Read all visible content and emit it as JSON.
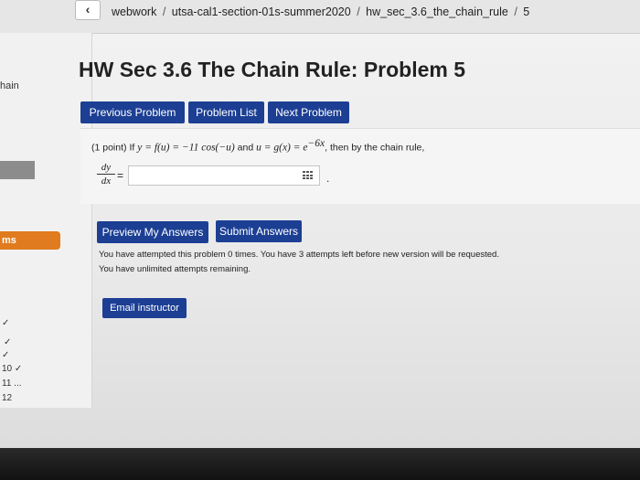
{
  "breadcrumb": {
    "items": [
      "webwork",
      "utsa-cal1-section-01s-summer2020",
      "hw_sec_3.6_the_chain_rule",
      "5"
    ],
    "separator": "/"
  },
  "sidebar": {
    "partial_title": "hain",
    "partial_section": "ms",
    "problem_marks": [
      "✓",
      "✓",
      "✓",
      "10 ✓",
      "11 ...",
      "12"
    ]
  },
  "page": {
    "title": "HW Sec 3.6 The Chain Rule: Problem 5"
  },
  "nav": {
    "previous_label": "Previous Problem",
    "list_label": "Problem List",
    "next_label": "Next Problem"
  },
  "problem": {
    "points": "(1 point)",
    "t1": "If",
    "t2": "y = f(u) = −11 cos(−u)",
    "t3": "and",
    "t4": "u = g(x) = e",
    "exponent": "−6x",
    "t5": ", then by the chain rule,",
    "lhs_num": "dy",
    "lhs_den": "dx",
    "equals": "=",
    "answer_value": "",
    "period": "."
  },
  "actions": {
    "preview_label": "Preview My Answers",
    "submit_label": "Submit Answers"
  },
  "attempts": {
    "line1": "You have attempted this problem 0 times. You have 3 attempts left before new version will be requested.",
    "line2": "You have unlimited attempts remaining."
  },
  "email": {
    "label": "Email instructor"
  },
  "colors": {
    "button_blue": "#1c3f94",
    "sidebar_orange": "#e07b1f"
  }
}
